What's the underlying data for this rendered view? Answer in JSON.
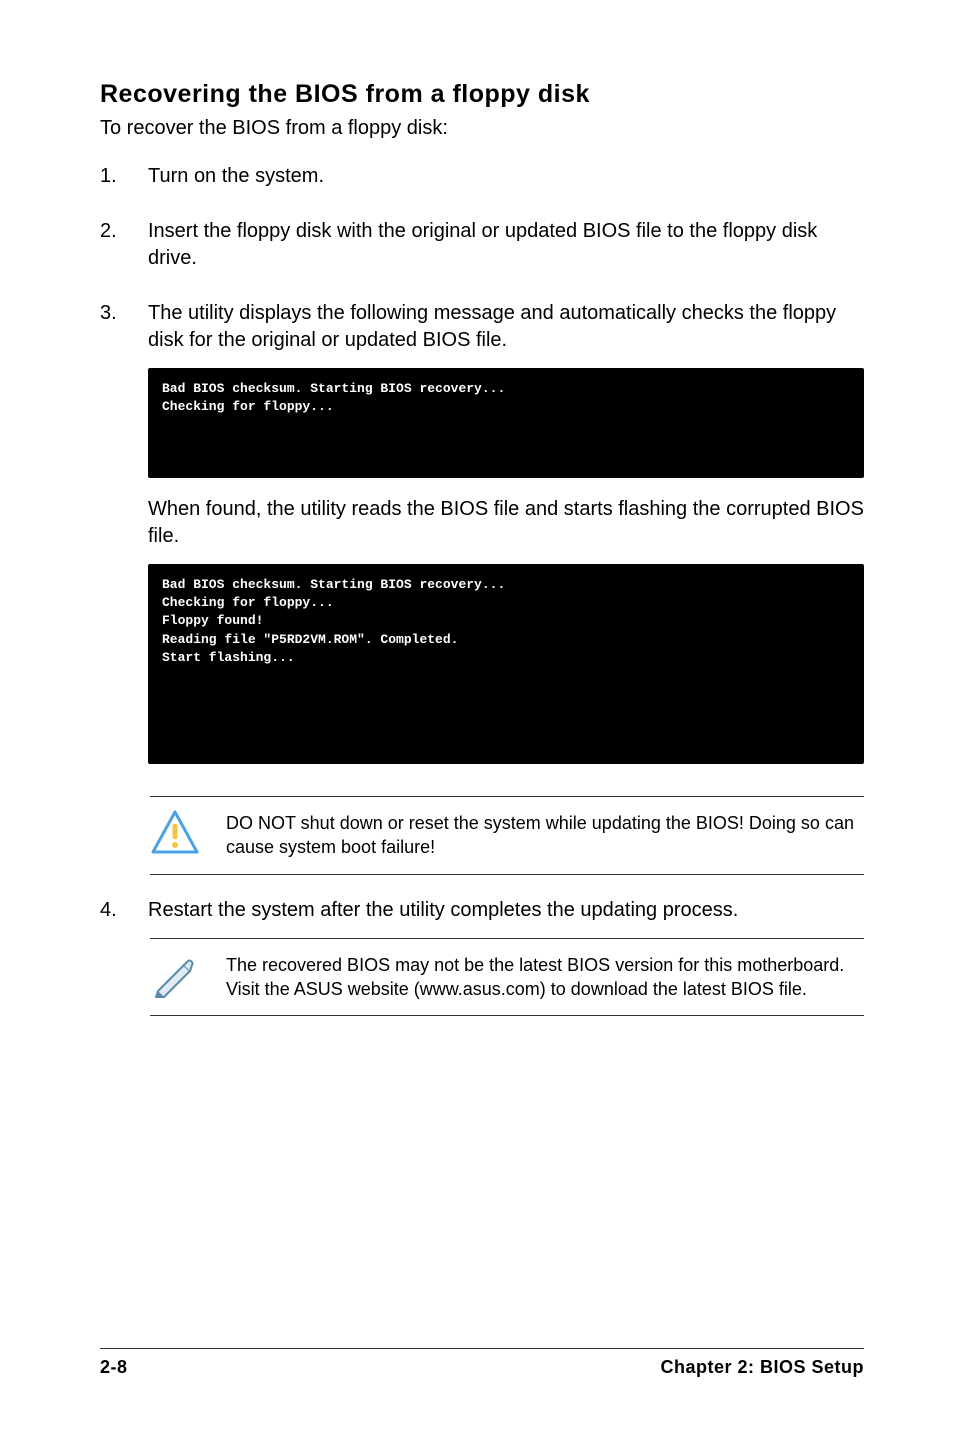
{
  "heading": "Recovering the BIOS from a floppy disk",
  "intro": "To recover the BIOS from a floppy disk:",
  "steps": {
    "s1": {
      "num": "1.",
      "text": "Turn on the system."
    },
    "s2": {
      "num": "2.",
      "text": "Insert the floppy disk with the original or updated BIOS file to the floppy disk drive."
    },
    "s3": {
      "num": "3.",
      "text": "The utility displays the following message and automatically checks the floppy disk for the original or updated BIOS file."
    },
    "s3_after": "When found, the utility reads the BIOS file and starts flashing the corrupted BIOS file.",
    "s4": {
      "num": "4.",
      "text": "Restart the system after the utility completes the updating process."
    }
  },
  "terminal1": "Bad BIOS checksum. Starting BIOS recovery...\nChecking for floppy...",
  "terminal2": "Bad BIOS checksum. Starting BIOS recovery...\nChecking for floppy...\nFloppy found!\nReading file \"P5RD2VM.ROM\". Completed.\nStart flashing...",
  "callout_warning": "DO NOT shut down or reset the system while updating the BIOS! Doing so can cause system boot failure!",
  "callout_note": "The recovered BIOS may not be the latest BIOS version for this motherboard. Visit the ASUS website (www.asus.com) to download the latest BIOS file.",
  "footer": {
    "page": "2-8",
    "chapter": "Chapter 2: BIOS Setup"
  }
}
